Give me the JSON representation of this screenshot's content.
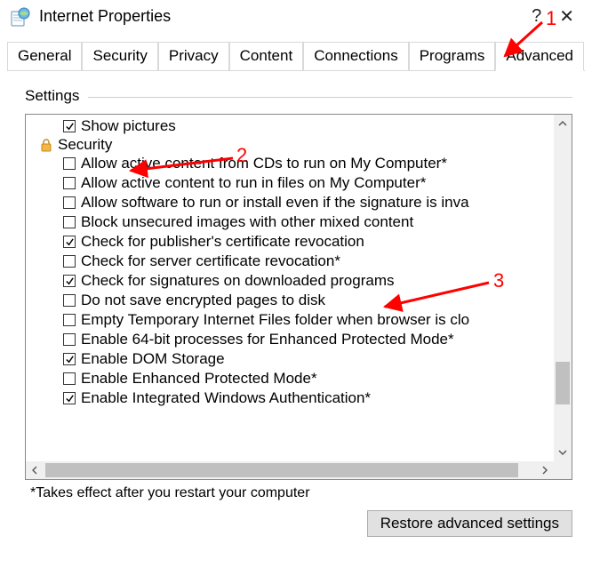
{
  "titlebar": {
    "title": "Internet Properties",
    "help_glyph": "?",
    "close_glyph": "✕"
  },
  "tabs": [
    {
      "label": "General",
      "active": false
    },
    {
      "label": "Security",
      "active": false
    },
    {
      "label": "Privacy",
      "active": false
    },
    {
      "label": "Content",
      "active": false
    },
    {
      "label": "Connections",
      "active": false
    },
    {
      "label": "Programs",
      "active": false
    },
    {
      "label": "Advanced",
      "active": true
    }
  ],
  "settings_header": "Settings",
  "group_label": "Security",
  "items": [
    {
      "label": "Show pictures",
      "checked": true,
      "indent": true
    },
    {
      "label": "Allow active content from CDs to run on My Computer*",
      "checked": false,
      "indent": true
    },
    {
      "label": "Allow active content to run in files on My Computer*",
      "checked": false,
      "indent": true
    },
    {
      "label": "Allow software to run or install even if the signature is inva",
      "checked": false,
      "indent": true
    },
    {
      "label": "Block unsecured images with other mixed content",
      "checked": false,
      "indent": true
    },
    {
      "label": "Check for publisher's certificate revocation",
      "checked": true,
      "indent": true
    },
    {
      "label": "Check for server certificate revocation*",
      "checked": false,
      "indent": true
    },
    {
      "label": "Check for signatures on downloaded programs",
      "checked": true,
      "indent": true
    },
    {
      "label": "Do not save encrypted pages to disk",
      "checked": false,
      "indent": true
    },
    {
      "label": "Empty Temporary Internet Files folder when browser is clo",
      "checked": false,
      "indent": true
    },
    {
      "label": "Enable 64-bit processes for Enhanced Protected Mode*",
      "checked": false,
      "indent": true
    },
    {
      "label": "Enable DOM Storage",
      "checked": true,
      "indent": true
    },
    {
      "label": "Enable Enhanced Protected Mode*",
      "checked": false,
      "indent": true
    },
    {
      "label": "Enable Integrated Windows Authentication*",
      "checked": true,
      "indent": true
    }
  ],
  "footnote": "*Takes effect after you restart your computer",
  "restore_button": "Restore advanced settings",
  "annotations": {
    "n1": "1",
    "n2": "2",
    "n3": "3"
  }
}
